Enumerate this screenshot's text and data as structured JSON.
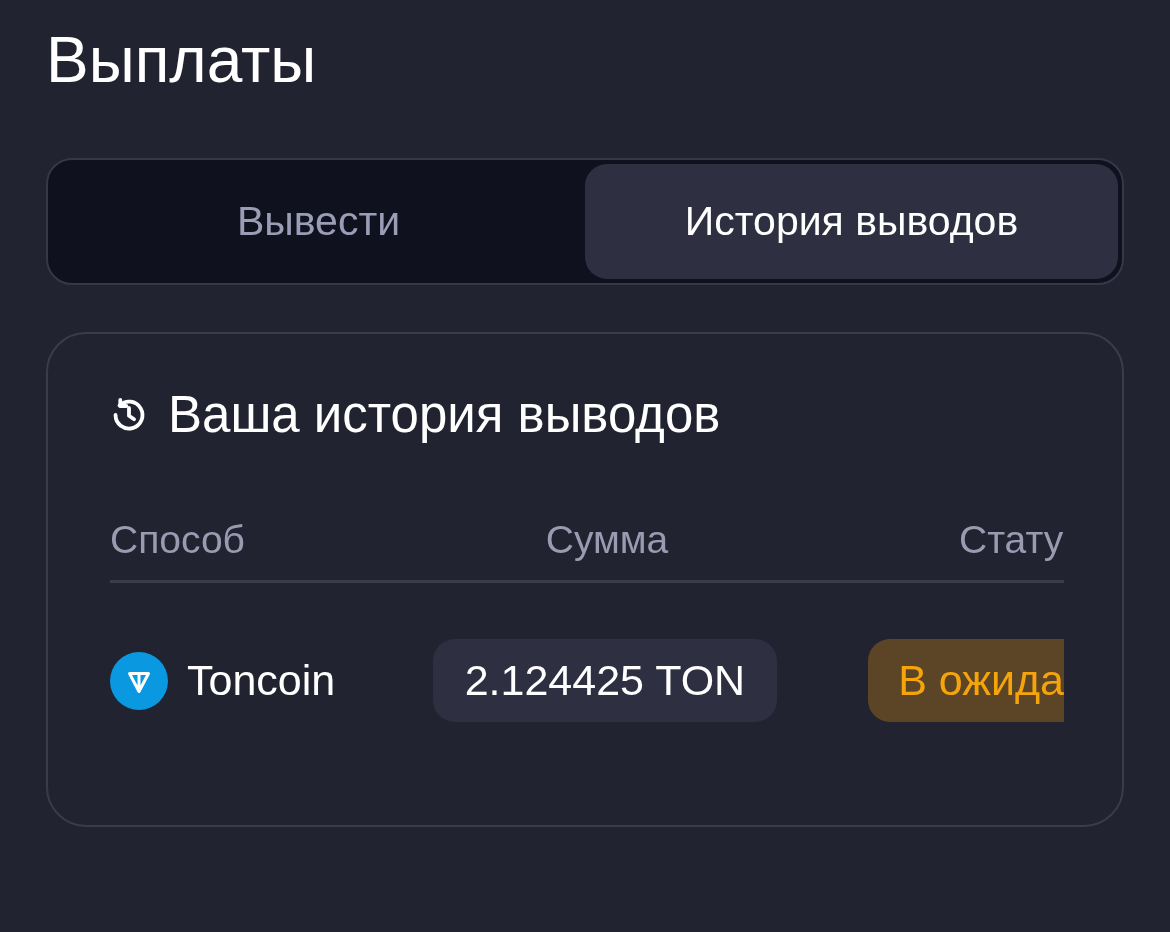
{
  "page": {
    "title": "Выплаты"
  },
  "tabs": [
    {
      "label": "Вывести",
      "selected": false
    },
    {
      "label": "История выводов",
      "selected": true
    }
  ],
  "history": {
    "title": "Ваша история выводов",
    "table": {
      "columns": [
        "Способ",
        "Сумма",
        "Стату"
      ],
      "rows": [
        {
          "method": "Toncoin",
          "amount": "2.124425 TON",
          "status": "В ожида",
          "kind": "pending"
        }
      ]
    }
  }
}
